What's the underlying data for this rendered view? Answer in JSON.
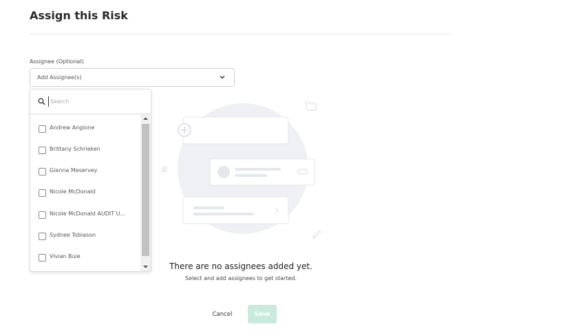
{
  "dialog": {
    "title": "Assign this Risk"
  },
  "assignee": {
    "label": "Assignee (Optional)",
    "select_value": "Add Assignee(s)",
    "search_placeholder": "Search",
    "options": [
      "Andrew Angione",
      "Brittany Schrieken",
      "Gianna Meservey",
      "Nicole McDonald",
      "Nicole McDonald AUDIT U...",
      "Sydnee Tobiason",
      "Vivian Buie"
    ]
  },
  "empty_state": {
    "title": "There are no assignees added yet.",
    "subtitle": "Select and add assignees to get started."
  },
  "footer": {
    "cancel_label": "Cancel",
    "save_label": "Save"
  },
  "colors": {
    "save_disabled": "#c9eadd",
    "illustration_bg": "#eef0f4",
    "scroll_thumb": "#c1c1c1"
  },
  "icons": {
    "search": "search-icon",
    "chevron": "chevron-down-icon"
  }
}
